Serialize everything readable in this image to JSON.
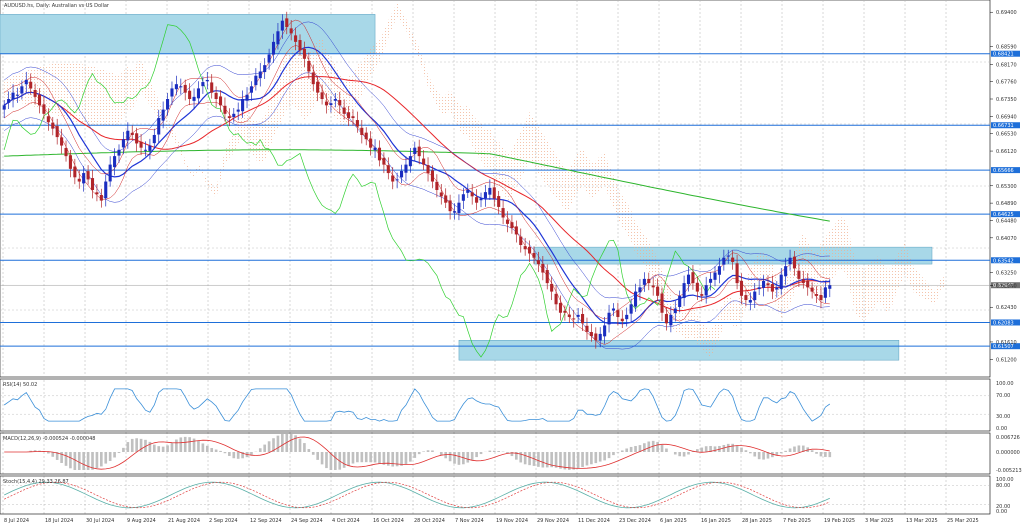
{
  "colors": {
    "background": "#ffffff",
    "grid": "#b0b0b0",
    "zone": "#a8d8e8",
    "level_line": "#1e6fd9",
    "level_tag": "#1e6fd9",
    "price_tag": "#707070",
    "candle_up": "#1a2dbf",
    "candle_down": "#b0252a",
    "ma_slow": "#2db52d",
    "ma_mid": "#e8262a",
    "ma_fast": "#1f35d6",
    "bb": "#3040d0",
    "envelope": "#d02020",
    "ichimoku_cloud": "#f0b090",
    "chikou": "#30d030",
    "rsi": "#3a8fd8",
    "macd_hist": "#c0c0c0",
    "macd_signal": "#e03030",
    "stoch_main": "#5ab0a8",
    "stoch_signal": "#e04040"
  },
  "chart_data": {
    "type": "candlestick",
    "title": "AUDUSD.hs, Daily:  Australian vs US Dollar",
    "price_axis": {
      "range": [
        0.609,
        0.695
      ],
      "ticks": [
        "0.69400",
        "0.68590",
        "0.68170",
        "0.67760",
        "0.67350",
        "0.66940",
        "0.66530",
        "0.66120",
        "0.65300",
        "0.64890",
        "0.64480",
        "0.64070",
        "0.63250",
        "0.62940",
        "0.62430",
        "0.61610",
        "0.61200"
      ]
    },
    "date_labels": [
      "8 Jul 2024",
      "18 Jul 2024",
      "30 Jul 2024",
      "9 Aug 2024",
      "21 Aug 2024",
      "2 Sep 2024",
      "12 Sep 2024",
      "24 Sep 2024",
      "4 Oct 2024",
      "16 Oct 2024",
      "28 Oct 2024",
      "7 Nov 2024",
      "19 Nov 2024",
      "29 Nov 2024",
      "11 Dec 2024",
      "23 Dec 2024",
      "6 Jan 2025",
      "16 Jan 2025",
      "28 Jan 2025",
      "7 Feb 2025",
      "19 Feb 2025",
      "3 Mar 2025",
      "13 Mar 2025",
      "25 Mar 2025"
    ],
    "level_tags": [
      "0.68421",
      "0.66731",
      "0.65666",
      "0.64625",
      "0.63542",
      "0.62083",
      "0.61507"
    ],
    "current_price_tag": "0.62947",
    "levels": [
      0.6842,
      0.6673,
      0.6567,
      0.6463,
      0.6354,
      0.6207,
      0.6151
    ],
    "zones": [
      {
        "from_index": 0,
        "to_index": 84,
        "top": 0.6935,
        "bottom": 0.6842
      },
      {
        "from_index": 120,
        "to_index": 190,
        "top": 0.6385,
        "bottom": 0.6345
      },
      {
        "from_index": 103,
        "to_index": 180,
        "top": 0.6165,
        "bottom": 0.6118
      }
    ],
    "close_series": [
      0.672,
      0.6735,
      0.675,
      0.6745,
      0.6765,
      0.678,
      0.676,
      0.674,
      0.672,
      0.67,
      0.668,
      0.6665,
      0.6645,
      0.6625,
      0.66,
      0.657,
      0.655,
      0.654,
      0.656,
      0.6545,
      0.652,
      0.651,
      0.6495,
      0.654,
      0.658,
      0.66,
      0.6615,
      0.664,
      0.666,
      0.665,
      0.663,
      0.662,
      0.6615,
      0.6625,
      0.665,
      0.669,
      0.671,
      0.6735,
      0.676,
      0.677,
      0.6765,
      0.675,
      0.6735,
      0.674,
      0.676,
      0.6775,
      0.678,
      0.675,
      0.6735,
      0.672,
      0.67,
      0.669,
      0.67,
      0.671,
      0.6735,
      0.6745,
      0.6765,
      0.679,
      0.68,
      0.6815,
      0.684,
      0.687,
      0.6895,
      0.692,
      0.6905,
      0.689,
      0.687,
      0.685,
      0.683,
      0.68,
      0.677,
      0.675,
      0.6735,
      0.672,
      0.6725,
      0.6735,
      0.672,
      0.67,
      0.669,
      0.669,
      0.667,
      0.665,
      0.664,
      0.662,
      0.662,
      0.659,
      0.658,
      0.656,
      0.654,
      0.6545,
      0.6565,
      0.658,
      0.66,
      0.662,
      0.66,
      0.658,
      0.656,
      0.654,
      0.652,
      0.6505,
      0.649,
      0.647,
      0.647,
      0.649,
      0.651,
      0.652,
      0.6505,
      0.649,
      0.65,
      0.6515,
      0.6525,
      0.65,
      0.648,
      0.6455,
      0.644,
      0.643,
      0.6415,
      0.639,
      0.638,
      0.637,
      0.636,
      0.6345,
      0.6325,
      0.63,
      0.628,
      0.625,
      0.623,
      0.623,
      0.622,
      0.6215,
      0.6225,
      0.6205,
      0.6185,
      0.6175,
      0.6165,
      0.618,
      0.62,
      0.623,
      0.624,
      0.622,
      0.621,
      0.6225,
      0.625,
      0.628,
      0.629,
      0.631,
      0.63,
      0.629,
      0.627,
      0.623,
      0.6205,
      0.6225,
      0.624,
      0.627,
      0.63,
      0.632,
      0.63,
      0.628,
      0.627,
      0.6295,
      0.631,
      0.6325,
      0.634,
      0.636,
      0.6365,
      0.635,
      0.63,
      0.627,
      0.626,
      0.626,
      0.628,
      0.629,
      0.6305,
      0.6295,
      0.628,
      0.629,
      0.632,
      0.634,
      0.636,
      0.6335,
      0.631,
      0.63,
      0.629,
      0.628,
      0.627,
      0.626,
      0.629,
      0.6295
    ],
    "indicators": {
      "rsi": {
        "label": "RSI(14) 50.02",
        "levels": [
          "100.00",
          "70.00",
          "30.00",
          "0.00"
        ]
      },
      "macd": {
        "label": "MACD(12,26,9) -0.000524 -0.000048",
        "levels": [
          "0.006726",
          "0.000000",
          "-0.005213"
        ]
      },
      "stoch": {
        "label": "Stoch(15,4,4) 29.33 26.87",
        "levels": [
          "100.00",
          "80.00",
          "20.00",
          "0.00"
        ]
      }
    }
  }
}
